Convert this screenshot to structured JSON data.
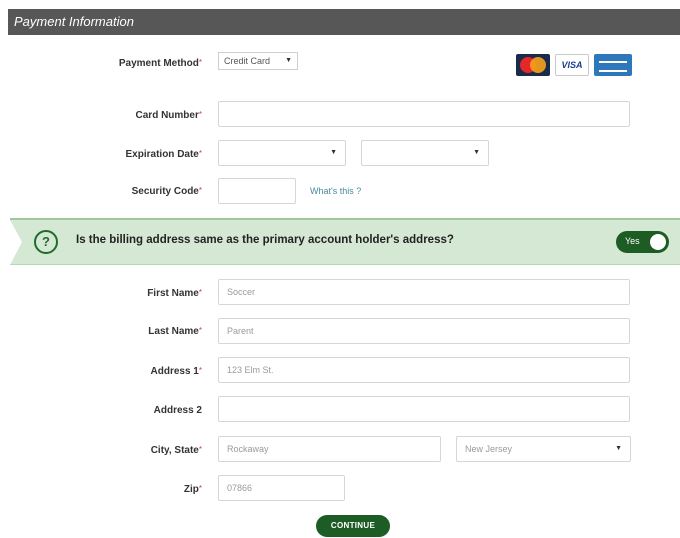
{
  "header": {
    "title": "Payment Information"
  },
  "payment_method": {
    "label": "Payment Method",
    "selected": "Credit Card",
    "cards": [
      {
        "name": "mastercard",
        "text": "",
        "color": "#1a2a4a"
      },
      {
        "name": "visa",
        "text": "VISA",
        "color": "#ffffff"
      },
      {
        "name": "american-express",
        "text": "",
        "color": "#2e77bb"
      }
    ]
  },
  "card_number": {
    "label": "Card Number",
    "value": ""
  },
  "expiration": {
    "label": "Expiration Date",
    "month": "",
    "year": ""
  },
  "security_code": {
    "label": "Security Code",
    "value": "",
    "help": "What's this ?"
  },
  "billing_question": {
    "icon": "question-icon",
    "text": "Is the billing address same as the primary account holder's address?",
    "toggle_label": "Yes",
    "toggle_on": true
  },
  "fields": {
    "first_name": {
      "label": "First Name",
      "value": "Soccer"
    },
    "last_name": {
      "label": "Last Name",
      "value": "Parent"
    },
    "address1": {
      "label": "Address 1",
      "value": "123 Elm St."
    },
    "address2": {
      "label": "Address 2",
      "value": ""
    },
    "city_state": {
      "label": "City, State",
      "city": "Rockaway",
      "state": "New Jersey"
    },
    "zip": {
      "label": "Zip",
      "value": "07866"
    }
  },
  "continue_label": "CONTINUE",
  "colors": {
    "accent": "#1d5c24",
    "banner": "#d5e8d3",
    "header": "#575757"
  }
}
